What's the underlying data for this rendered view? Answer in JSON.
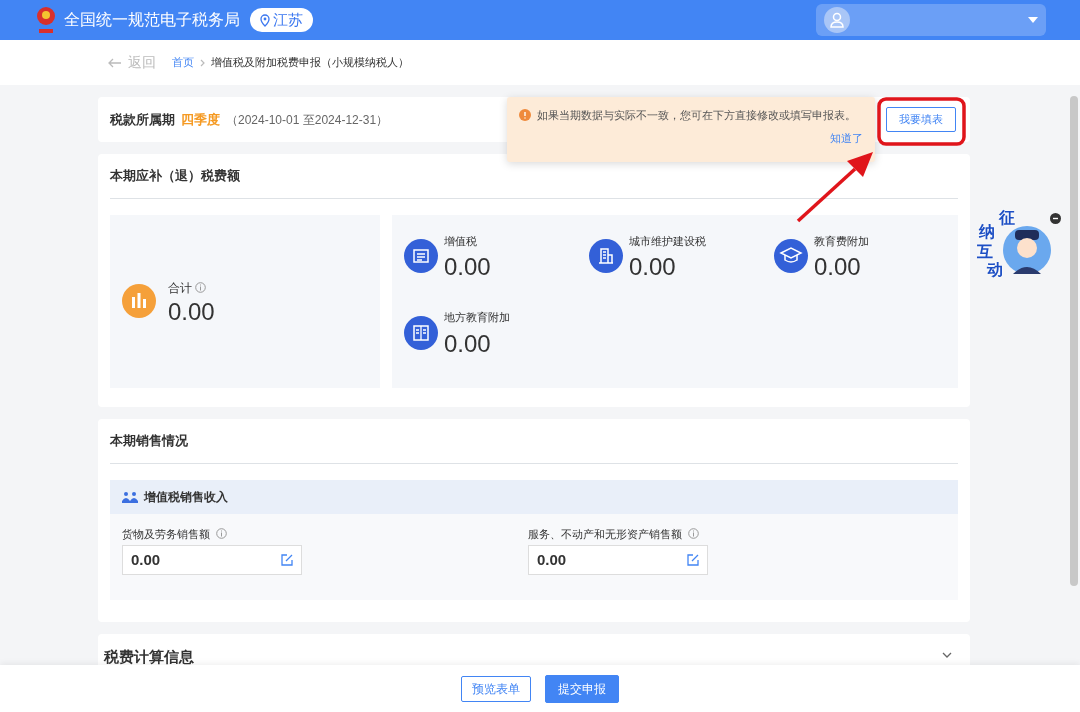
{
  "header": {
    "title": "全国统一规范电子税务局",
    "region": "江苏"
  },
  "breadcrumb": {
    "back": "返回",
    "items": [
      "首页",
      "增值税及附加税费申报（小规模纳税人）"
    ]
  },
  "period": {
    "label": "税款所属期",
    "quarter": "四季度",
    "range": "（2024-10-01 至2024-12-31）",
    "fill_button": "我要填表"
  },
  "notice": {
    "message": "如果当期数据与实际不一致，您可在下方直接修改或填写申报表。",
    "dismiss": "知道了"
  },
  "tax_summary": {
    "title": "本期应补（退）税费额",
    "total": {
      "label": "合计",
      "value": "0.00"
    },
    "items": [
      {
        "label": "增值税",
        "value": "0.00",
        "kind": "doc"
      },
      {
        "label": "城市维护建设税",
        "value": "0.00",
        "kind": "building"
      },
      {
        "label": "教育费附加",
        "value": "0.00",
        "kind": "cap"
      },
      {
        "label": "地方教育附加",
        "value": "0.00",
        "kind": "book"
      }
    ]
  },
  "sales": {
    "title": "本期销售情况",
    "section_title": "增值税销售收入",
    "fields": [
      {
        "label": "货物及劳务销售额",
        "value": "0.00"
      },
      {
        "label": "服务、不动产和无形资产销售额",
        "value": "0.00"
      }
    ]
  },
  "calc": {
    "title": "税费计算信息",
    "expanded": false
  },
  "mascot": {
    "characters": [
      "征",
      "纳",
      "互",
      "动"
    ]
  },
  "footer_buttons": [
    {
      "label": "预览表单",
      "kind": "outline"
    },
    {
      "label": "提交申报",
      "kind": "primary"
    }
  ]
}
